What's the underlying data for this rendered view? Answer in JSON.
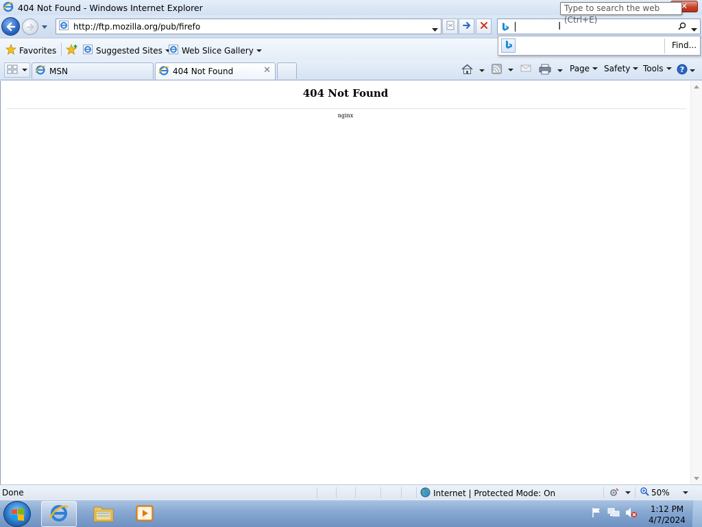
{
  "window": {
    "title": "404 Not Found - Windows Internet Explorer",
    "close_label": "✕"
  },
  "tooltip": "Type to search the web (Ctrl+E)",
  "address": {
    "url": "http://ftp.mozilla.org/pub/firefo"
  },
  "search": {
    "value": "",
    "suggest_find_label": "Find..."
  },
  "favorites": {
    "favorites_label": "Favorites",
    "items": [
      {
        "label": "Suggested Sites"
      },
      {
        "label": "Web Slice Gallery"
      }
    ]
  },
  "tabs": [
    {
      "label": "MSN"
    },
    {
      "label": "404 Not Found"
    }
  ],
  "command_bar": {
    "page_label": "Page",
    "safety_label": "Safety",
    "tools_label": "Tools"
  },
  "page": {
    "heading": "404 Not Found",
    "server": "nginx"
  },
  "status": {
    "text": "Done",
    "zone": "Internet | Protected Mode: On",
    "zoom": "50%"
  },
  "clock": {
    "time": "1:12 PM",
    "date": "4/7/2024"
  },
  "colors": {
    "accent": "#2a66c2",
    "close": "#c8432a",
    "taskbar": "#86a7d1"
  },
  "icons": [
    "ie-icon",
    "back-arrow-icon",
    "forward-arrow-icon",
    "compatibility-icon",
    "go-arrow-icon",
    "stop-icon",
    "bing-icon",
    "search-magnifier-icon",
    "star-icon",
    "add-favorites-icon",
    "quick-tabs-icon",
    "home-icon",
    "feeds-icon",
    "mail-icon",
    "print-icon",
    "help-icon",
    "globe-icon",
    "settings-icon",
    "zoom-icon",
    "windows-logo-icon",
    "folder-icon",
    "media-player-icon",
    "flag-icon",
    "network-icon",
    "volume-muted-icon"
  ]
}
